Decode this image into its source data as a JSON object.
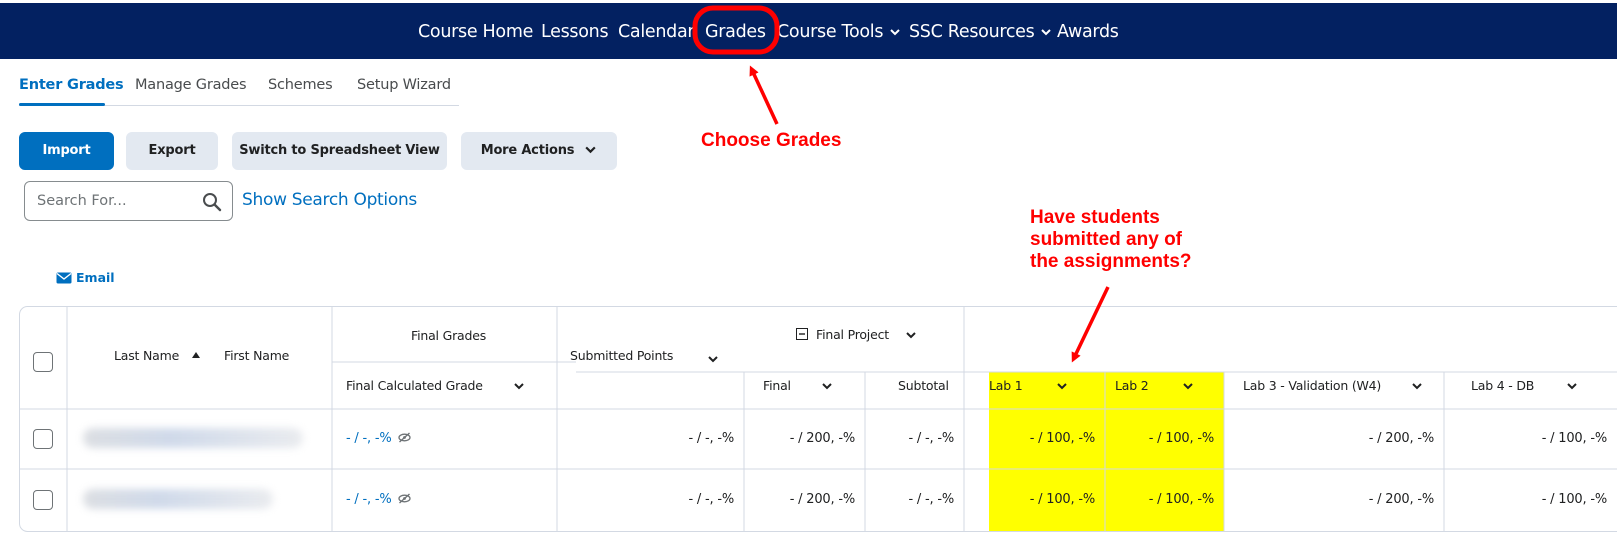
{
  "nav": {
    "items": [
      {
        "label": "Course Home"
      },
      {
        "label": "Lessons"
      },
      {
        "label": "Calendar"
      },
      {
        "label": "Grades"
      },
      {
        "label": "Course Tools",
        "dropdown": true
      },
      {
        "label": "SSC Resources",
        "dropdown": true
      },
      {
        "label": "Awards"
      }
    ],
    "active": "Grades",
    "background": "#032161"
  },
  "subtabs": {
    "items": [
      "Enter Grades",
      "Manage Grades",
      "Schemes",
      "Setup Wizard"
    ],
    "active": "Enter Grades"
  },
  "toolbar": {
    "import": "Import",
    "export": "Export",
    "switch_view": "Switch to Spreadsheet View",
    "more_actions": "More Actions"
  },
  "search": {
    "placeholder": "Search For...",
    "options_link": "Show Search Options"
  },
  "email_label": "Email",
  "annotations": {
    "choose_grades": "Choose Grades",
    "question_lines": [
      "Have students",
      "submitted any of",
      "the assignments?"
    ]
  },
  "grid": {
    "name_header": {
      "last": "Last Name",
      "first": "First Name",
      "sort": "ascending"
    },
    "final_grades_group": "Final Grades",
    "final_calculated_grade": "Final Calculated Grade",
    "submitted_points": "Submitted Points",
    "final_project_group": "Final Project",
    "final": "Final",
    "subtotal": "Subtotal",
    "columns": [
      "Lab 1",
      "Lab 2",
      "Lab 3 - Validation (W4)",
      "Lab 4 - DB"
    ],
    "rows": [
      {
        "final_calc": "- / -, -%",
        "submitted": "- / -, -%",
        "final": "- / 200, -%",
        "subtotal": "- / -, -%",
        "lab1": "- / 100, -%",
        "lab2": "- / 100, -%",
        "lab3": "- / 200, -%",
        "lab4": "- / 100, -%"
      },
      {
        "final_calc": "- / -, -%",
        "submitted": "- / -, -%",
        "final": "- / 200, -%",
        "subtotal": "- / -, -%",
        "lab1": "- / 100, -%",
        "lab2": "- / 100, -%",
        "lab3": "- / 200, -%",
        "lab4": "- / 100, -%"
      }
    ],
    "highlight_color": "#ffff00"
  },
  "colors": {
    "accent": "#006fbf",
    "annotation": "#ff0000"
  }
}
